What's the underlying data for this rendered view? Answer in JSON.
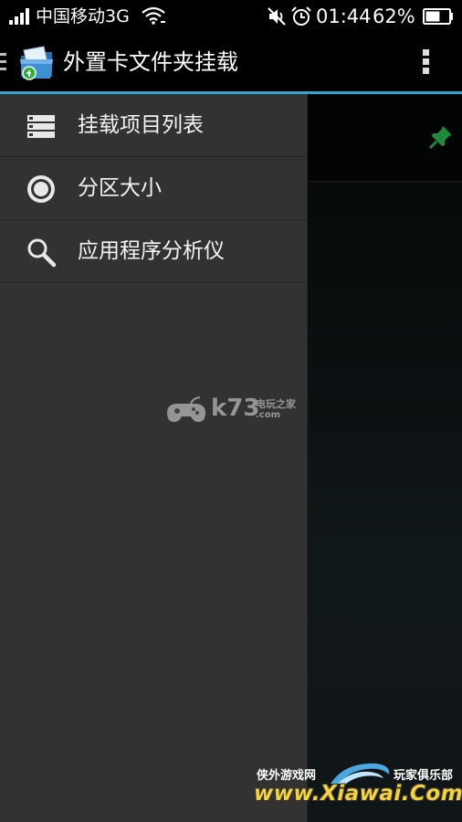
{
  "status_bar": {
    "carrier": "中国移动3G",
    "time": "01:44",
    "battery_percent": "62%",
    "battery_level": 0.62,
    "icons": [
      "signal-icon",
      "wifi-icon",
      "mute-icon",
      "alarm-icon",
      "battery-icon"
    ]
  },
  "action_bar": {
    "title": "外置卡文件夹挂载",
    "icons": [
      "app-icon",
      "overflow-menu-icon"
    ]
  },
  "drawer": {
    "items": [
      {
        "label": "挂载项目列表",
        "icon": "list-icon"
      },
      {
        "label": "分区大小",
        "icon": "target-icon"
      },
      {
        "label": "应用程序分析仪",
        "icon": "search-icon"
      }
    ]
  },
  "main": {
    "row_icon": "pin-icon"
  },
  "watermarks": {
    "k73": {
      "brand": "k73",
      "tagline": "电玩之家",
      "domain": ".com"
    },
    "xiawai": {
      "left": "侠外游戏网",
      "right": "玩家俱乐部",
      "domain": "www.Xiawai.Com"
    }
  },
  "colors": {
    "accent": "#33a6d1",
    "drawer_bg": "#323232",
    "pin": "#1f8a3c",
    "xiawai_text": "#f3d23a"
  }
}
